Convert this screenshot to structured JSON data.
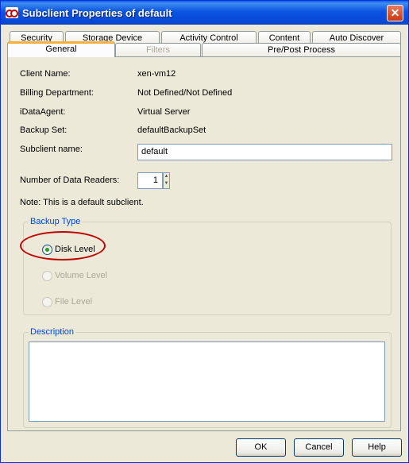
{
  "window": {
    "title": "Subclient Properties of default",
    "icon": "commvault-logo-icon",
    "close_glyph": "✕"
  },
  "tabs": {
    "row_back": [
      "Security",
      "Storage Device",
      "Activity Control",
      "Content",
      "Auto Discover"
    ],
    "row_front": [
      "General",
      "Filters",
      "Pre/Post Process"
    ],
    "active": "General",
    "disabled": [
      "Filters"
    ]
  },
  "general": {
    "client_name_label": "Client Name:",
    "client_name_value": "xen-vm12",
    "billing_label": "Billing Department:",
    "billing_value": "Not Defined/Not Defined",
    "agent_label": "iDataAgent:",
    "agent_value": "Virtual Server",
    "backup_set_label": "Backup Set:",
    "backup_set_value": "defaultBackupSet",
    "subclient_name_label": "Subclient name:",
    "subclient_name_value": "default",
    "data_readers_label": "Number of Data Readers:",
    "data_readers_value": "1",
    "note": "Note: This is a default subclient."
  },
  "backup_type": {
    "title": "Backup Type",
    "options": [
      {
        "label": "Disk Level",
        "checked": true,
        "enabled": true
      },
      {
        "label": "Volume Level",
        "checked": false,
        "enabled": false
      },
      {
        "label": "File Level",
        "checked": false,
        "enabled": false
      }
    ]
  },
  "description": {
    "title": "Description",
    "value": ""
  },
  "buttons": {
    "ok": "OK",
    "cancel": "Cancel",
    "help": "Help"
  },
  "colors": {
    "title_bar": "#0a54e0",
    "active_tab_accent": "#f4b13d",
    "group_title": "#0046d5",
    "highlight_circle": "#c00000"
  }
}
